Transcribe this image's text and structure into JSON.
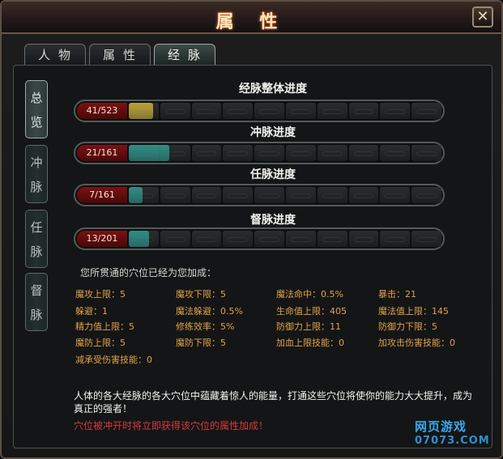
{
  "window": {
    "title": "属 性",
    "close_label": "✕"
  },
  "tabs": [
    {
      "label": "人物"
    },
    {
      "label": "属性"
    },
    {
      "label": "经脉",
      "active": true
    }
  ],
  "side_tabs": [
    {
      "label": "总览",
      "active": true
    },
    {
      "label": "冲脉"
    },
    {
      "label": "任脉"
    },
    {
      "label": "督脉"
    }
  ],
  "progress": [
    {
      "title": "经脉整体进度",
      "count": "41/523",
      "current": 41,
      "total": 523,
      "fill_color": "#b9a23a"
    },
    {
      "title": "冲脉进度",
      "count": "21/161",
      "current": 21,
      "total": 161,
      "fill_color": "#2f8c86"
    },
    {
      "title": "任脉进度",
      "count": "7/161",
      "current": 7,
      "total": 161,
      "fill_color": "#2f8c86"
    },
    {
      "title": "督脉进度",
      "count": "13/201",
      "current": 13,
      "total": 201,
      "fill_color": "#2f8c86"
    }
  ],
  "bonus": {
    "heading": "您所贯通的穴位已经为您加成：",
    "stats": [
      [
        "魔攻上限：5",
        "魔攻下限：5",
        "魔法命中：0.5%",
        "暴击：21"
      ],
      [
        "躲避：1",
        "魔法躲避：0.5%",
        "生命值上限：405",
        "魔法值上限：145"
      ],
      [
        "精力值上限：5",
        "修练效率：5%",
        "防御力上限：11",
        "防御力下限：5"
      ],
      [
        "魔防上限：5",
        "魔防下限：5",
        "加血上限技能：0",
        "加攻击伤害技能：0"
      ],
      [
        "减承受伤害技能：0"
      ]
    ]
  },
  "description": "人体的各大经脉的各大穴位中蕴藏着惊人的能量，打通这些穴位将使你的能力大大提升，成为真正的强者！",
  "note": "穴位被冲开时将立即获得该穴位的属性加成！",
  "watermark": {
    "line1": "网页游戏",
    "line2": "07073.COM"
  },
  "colors": {
    "accent_red": "#d53a3a",
    "stat_orange": "#e3a24a"
  }
}
